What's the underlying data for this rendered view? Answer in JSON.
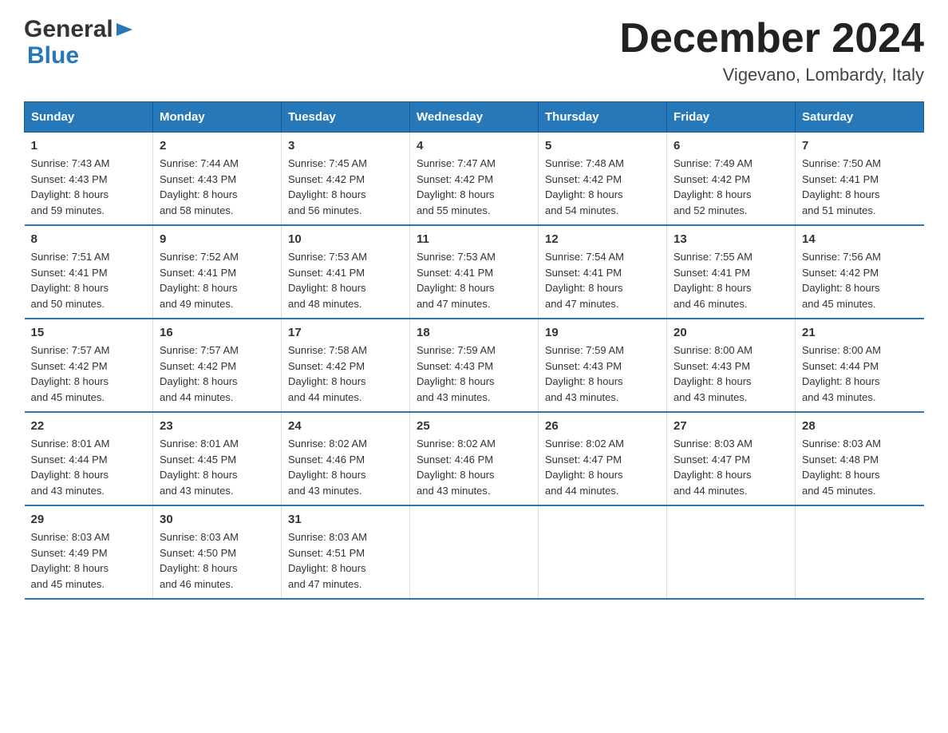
{
  "header": {
    "logo": {
      "general": "General",
      "blue": "Blue",
      "triangle": "▶"
    },
    "title": "December 2024",
    "location": "Vigevano, Lombardy, Italy"
  },
  "days_of_week": [
    "Sunday",
    "Monday",
    "Tuesday",
    "Wednesday",
    "Thursday",
    "Friday",
    "Saturday"
  ],
  "weeks": [
    [
      {
        "day": "1",
        "sunrise": "7:43 AM",
        "sunset": "4:43 PM",
        "daylight": "8 hours and 59 minutes."
      },
      {
        "day": "2",
        "sunrise": "7:44 AM",
        "sunset": "4:43 PM",
        "daylight": "8 hours and 58 minutes."
      },
      {
        "day": "3",
        "sunrise": "7:45 AM",
        "sunset": "4:42 PM",
        "daylight": "8 hours and 56 minutes."
      },
      {
        "day": "4",
        "sunrise": "7:47 AM",
        "sunset": "4:42 PM",
        "daylight": "8 hours and 55 minutes."
      },
      {
        "day": "5",
        "sunrise": "7:48 AM",
        "sunset": "4:42 PM",
        "daylight": "8 hours and 54 minutes."
      },
      {
        "day": "6",
        "sunrise": "7:49 AM",
        "sunset": "4:42 PM",
        "daylight": "8 hours and 52 minutes."
      },
      {
        "day": "7",
        "sunrise": "7:50 AM",
        "sunset": "4:41 PM",
        "daylight": "8 hours and 51 minutes."
      }
    ],
    [
      {
        "day": "8",
        "sunrise": "7:51 AM",
        "sunset": "4:41 PM",
        "daylight": "8 hours and 50 minutes."
      },
      {
        "day": "9",
        "sunrise": "7:52 AM",
        "sunset": "4:41 PM",
        "daylight": "8 hours and 49 minutes."
      },
      {
        "day": "10",
        "sunrise": "7:53 AM",
        "sunset": "4:41 PM",
        "daylight": "8 hours and 48 minutes."
      },
      {
        "day": "11",
        "sunrise": "7:53 AM",
        "sunset": "4:41 PM",
        "daylight": "8 hours and 47 minutes."
      },
      {
        "day": "12",
        "sunrise": "7:54 AM",
        "sunset": "4:41 PM",
        "daylight": "8 hours and 47 minutes."
      },
      {
        "day": "13",
        "sunrise": "7:55 AM",
        "sunset": "4:41 PM",
        "daylight": "8 hours and 46 minutes."
      },
      {
        "day": "14",
        "sunrise": "7:56 AM",
        "sunset": "4:42 PM",
        "daylight": "8 hours and 45 minutes."
      }
    ],
    [
      {
        "day": "15",
        "sunrise": "7:57 AM",
        "sunset": "4:42 PM",
        "daylight": "8 hours and 45 minutes."
      },
      {
        "day": "16",
        "sunrise": "7:57 AM",
        "sunset": "4:42 PM",
        "daylight": "8 hours and 44 minutes."
      },
      {
        "day": "17",
        "sunrise": "7:58 AM",
        "sunset": "4:42 PM",
        "daylight": "8 hours and 44 minutes."
      },
      {
        "day": "18",
        "sunrise": "7:59 AM",
        "sunset": "4:43 PM",
        "daylight": "8 hours and 43 minutes."
      },
      {
        "day": "19",
        "sunrise": "7:59 AM",
        "sunset": "4:43 PM",
        "daylight": "8 hours and 43 minutes."
      },
      {
        "day": "20",
        "sunrise": "8:00 AM",
        "sunset": "4:43 PM",
        "daylight": "8 hours and 43 minutes."
      },
      {
        "day": "21",
        "sunrise": "8:00 AM",
        "sunset": "4:44 PM",
        "daylight": "8 hours and 43 minutes."
      }
    ],
    [
      {
        "day": "22",
        "sunrise": "8:01 AM",
        "sunset": "4:44 PM",
        "daylight": "8 hours and 43 minutes."
      },
      {
        "day": "23",
        "sunrise": "8:01 AM",
        "sunset": "4:45 PM",
        "daylight": "8 hours and 43 minutes."
      },
      {
        "day": "24",
        "sunrise": "8:02 AM",
        "sunset": "4:46 PM",
        "daylight": "8 hours and 43 minutes."
      },
      {
        "day": "25",
        "sunrise": "8:02 AM",
        "sunset": "4:46 PM",
        "daylight": "8 hours and 43 minutes."
      },
      {
        "day": "26",
        "sunrise": "8:02 AM",
        "sunset": "4:47 PM",
        "daylight": "8 hours and 44 minutes."
      },
      {
        "day": "27",
        "sunrise": "8:03 AM",
        "sunset": "4:47 PM",
        "daylight": "8 hours and 44 minutes."
      },
      {
        "day": "28",
        "sunrise": "8:03 AM",
        "sunset": "4:48 PM",
        "daylight": "8 hours and 45 minutes."
      }
    ],
    [
      {
        "day": "29",
        "sunrise": "8:03 AM",
        "sunset": "4:49 PM",
        "daylight": "8 hours and 45 minutes."
      },
      {
        "day": "30",
        "sunrise": "8:03 AM",
        "sunset": "4:50 PM",
        "daylight": "8 hours and 46 minutes."
      },
      {
        "day": "31",
        "sunrise": "8:03 AM",
        "sunset": "4:51 PM",
        "daylight": "8 hours and 47 minutes."
      },
      null,
      null,
      null,
      null
    ]
  ],
  "labels": {
    "sunrise": "Sunrise:",
    "sunset": "Sunset:",
    "daylight": "Daylight:"
  }
}
